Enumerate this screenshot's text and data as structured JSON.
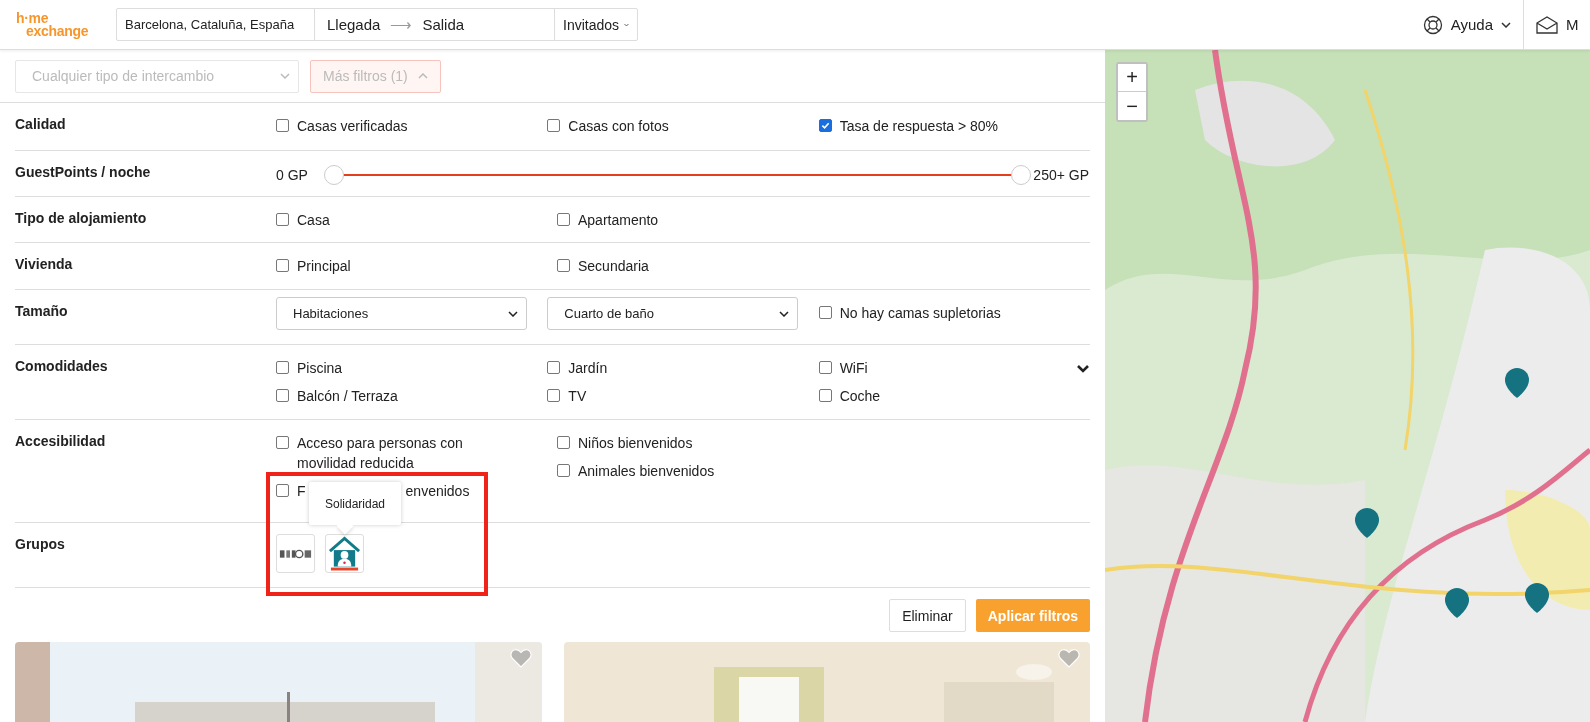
{
  "header": {
    "logo": [
      "h·me",
      "exchange"
    ],
    "location": "Barcelona, Cataluña, España",
    "checkin": "Llegada",
    "arrow": "⟶",
    "checkout": "Salida",
    "guests": "Invitados",
    "help": "Ayuda",
    "messages": "M"
  },
  "filter_bar": {
    "exchange_type": {
      "placeholder": "Cualquier tipo de intercambio",
      "disabled": true
    },
    "more_filters": {
      "label": "Más filtros (1)",
      "expanded": true
    }
  },
  "rows": [
    {
      "label": "Calidad",
      "kind": "checks",
      "columns": [
        [
          {
            "kind": "check",
            "label": "Casas verificadas",
            "checked": false
          }
        ],
        [
          {
            "kind": "check",
            "label": "Casas con fotos",
            "checked": false
          }
        ],
        [
          {
            "kind": "check",
            "label": "Tasa de respuesta > 80%",
            "checked": true
          }
        ]
      ]
    },
    {
      "label": "GuestPoints / noche",
      "kind": "range",
      "min_label": "0 GP",
      "max_label": "250+ GP",
      "level": 1
    },
    {
      "label": "Tipo de alojamiento",
      "kind": "checks",
      "columns": [
        [
          {
            "kind": "check",
            "label": "Casa",
            "checked": false
          }
        ],
        [
          {
            "kind": "check",
            "label": "Apartamento",
            "checked": false
          }
        ]
      ]
    },
    {
      "label": "Vivienda",
      "kind": "checks",
      "columns": [
        [
          {
            "kind": "check",
            "label": "Principal",
            "checked": false
          }
        ],
        [
          {
            "kind": "check",
            "label": "Secundaria",
            "checked": false
          }
        ]
      ]
    },
    {
      "label": "Tamaño",
      "kind": "checks",
      "columns": [
        [
          {
            "kind": "select",
            "label": "Habitaciones"
          }
        ],
        [
          {
            "kind": "select",
            "label": "Cuarto de baño"
          }
        ],
        [
          {
            "kind": "check",
            "label": "No hay camas supletorias",
            "checked": false
          }
        ]
      ]
    },
    {
      "label": "Comodidades",
      "kind": "checks",
      "expanded": false,
      "columns": [
        [
          {
            "kind": "check",
            "label": "Piscina",
            "checked": false
          },
          {
            "kind": "check",
            "label": "Balcón / Terraza",
            "checked": false
          }
        ],
        [
          {
            "kind": "check",
            "label": "Jardín",
            "checked": false
          },
          {
            "kind": "check",
            "label": "TV",
            "checked": false
          }
        ],
        [
          {
            "kind": "check",
            "label": "WiFi",
            "checked": false
          },
          {
            "kind": "check",
            "label": "Coche",
            "checked": false
          }
        ]
      ]
    },
    {
      "label": "Accesibilidad",
      "kind": "checks",
      "columns": [
        [
          {
            "kind": "check",
            "label": "Acceso para personas con movilidad reducida",
            "checked": false
          },
          {
            "kind": "check",
            "label_parts": [
              "F",
              "envenidos"
            ],
            "checked": false
          }
        ],
        [
          {
            "kind": "check",
            "label": "Niños bienvenidos",
            "checked": false
          },
          {
            "kind": "check",
            "label": "Animales bienvenidos",
            "checked": false
          }
        ]
      ]
    },
    {
      "label": "Grupos",
      "kind": "groups",
      "groups": [
        {
          "kind": "jobs"
        },
        {
          "kind": "solidarity",
          "tooltip": "Solidaridad"
        }
      ]
    }
  ],
  "actions": {
    "clear": "Eliminar",
    "apply": "Aplicar filtros"
  },
  "map": {
    "zoom_in": "+",
    "zoom_out": "−"
  }
}
